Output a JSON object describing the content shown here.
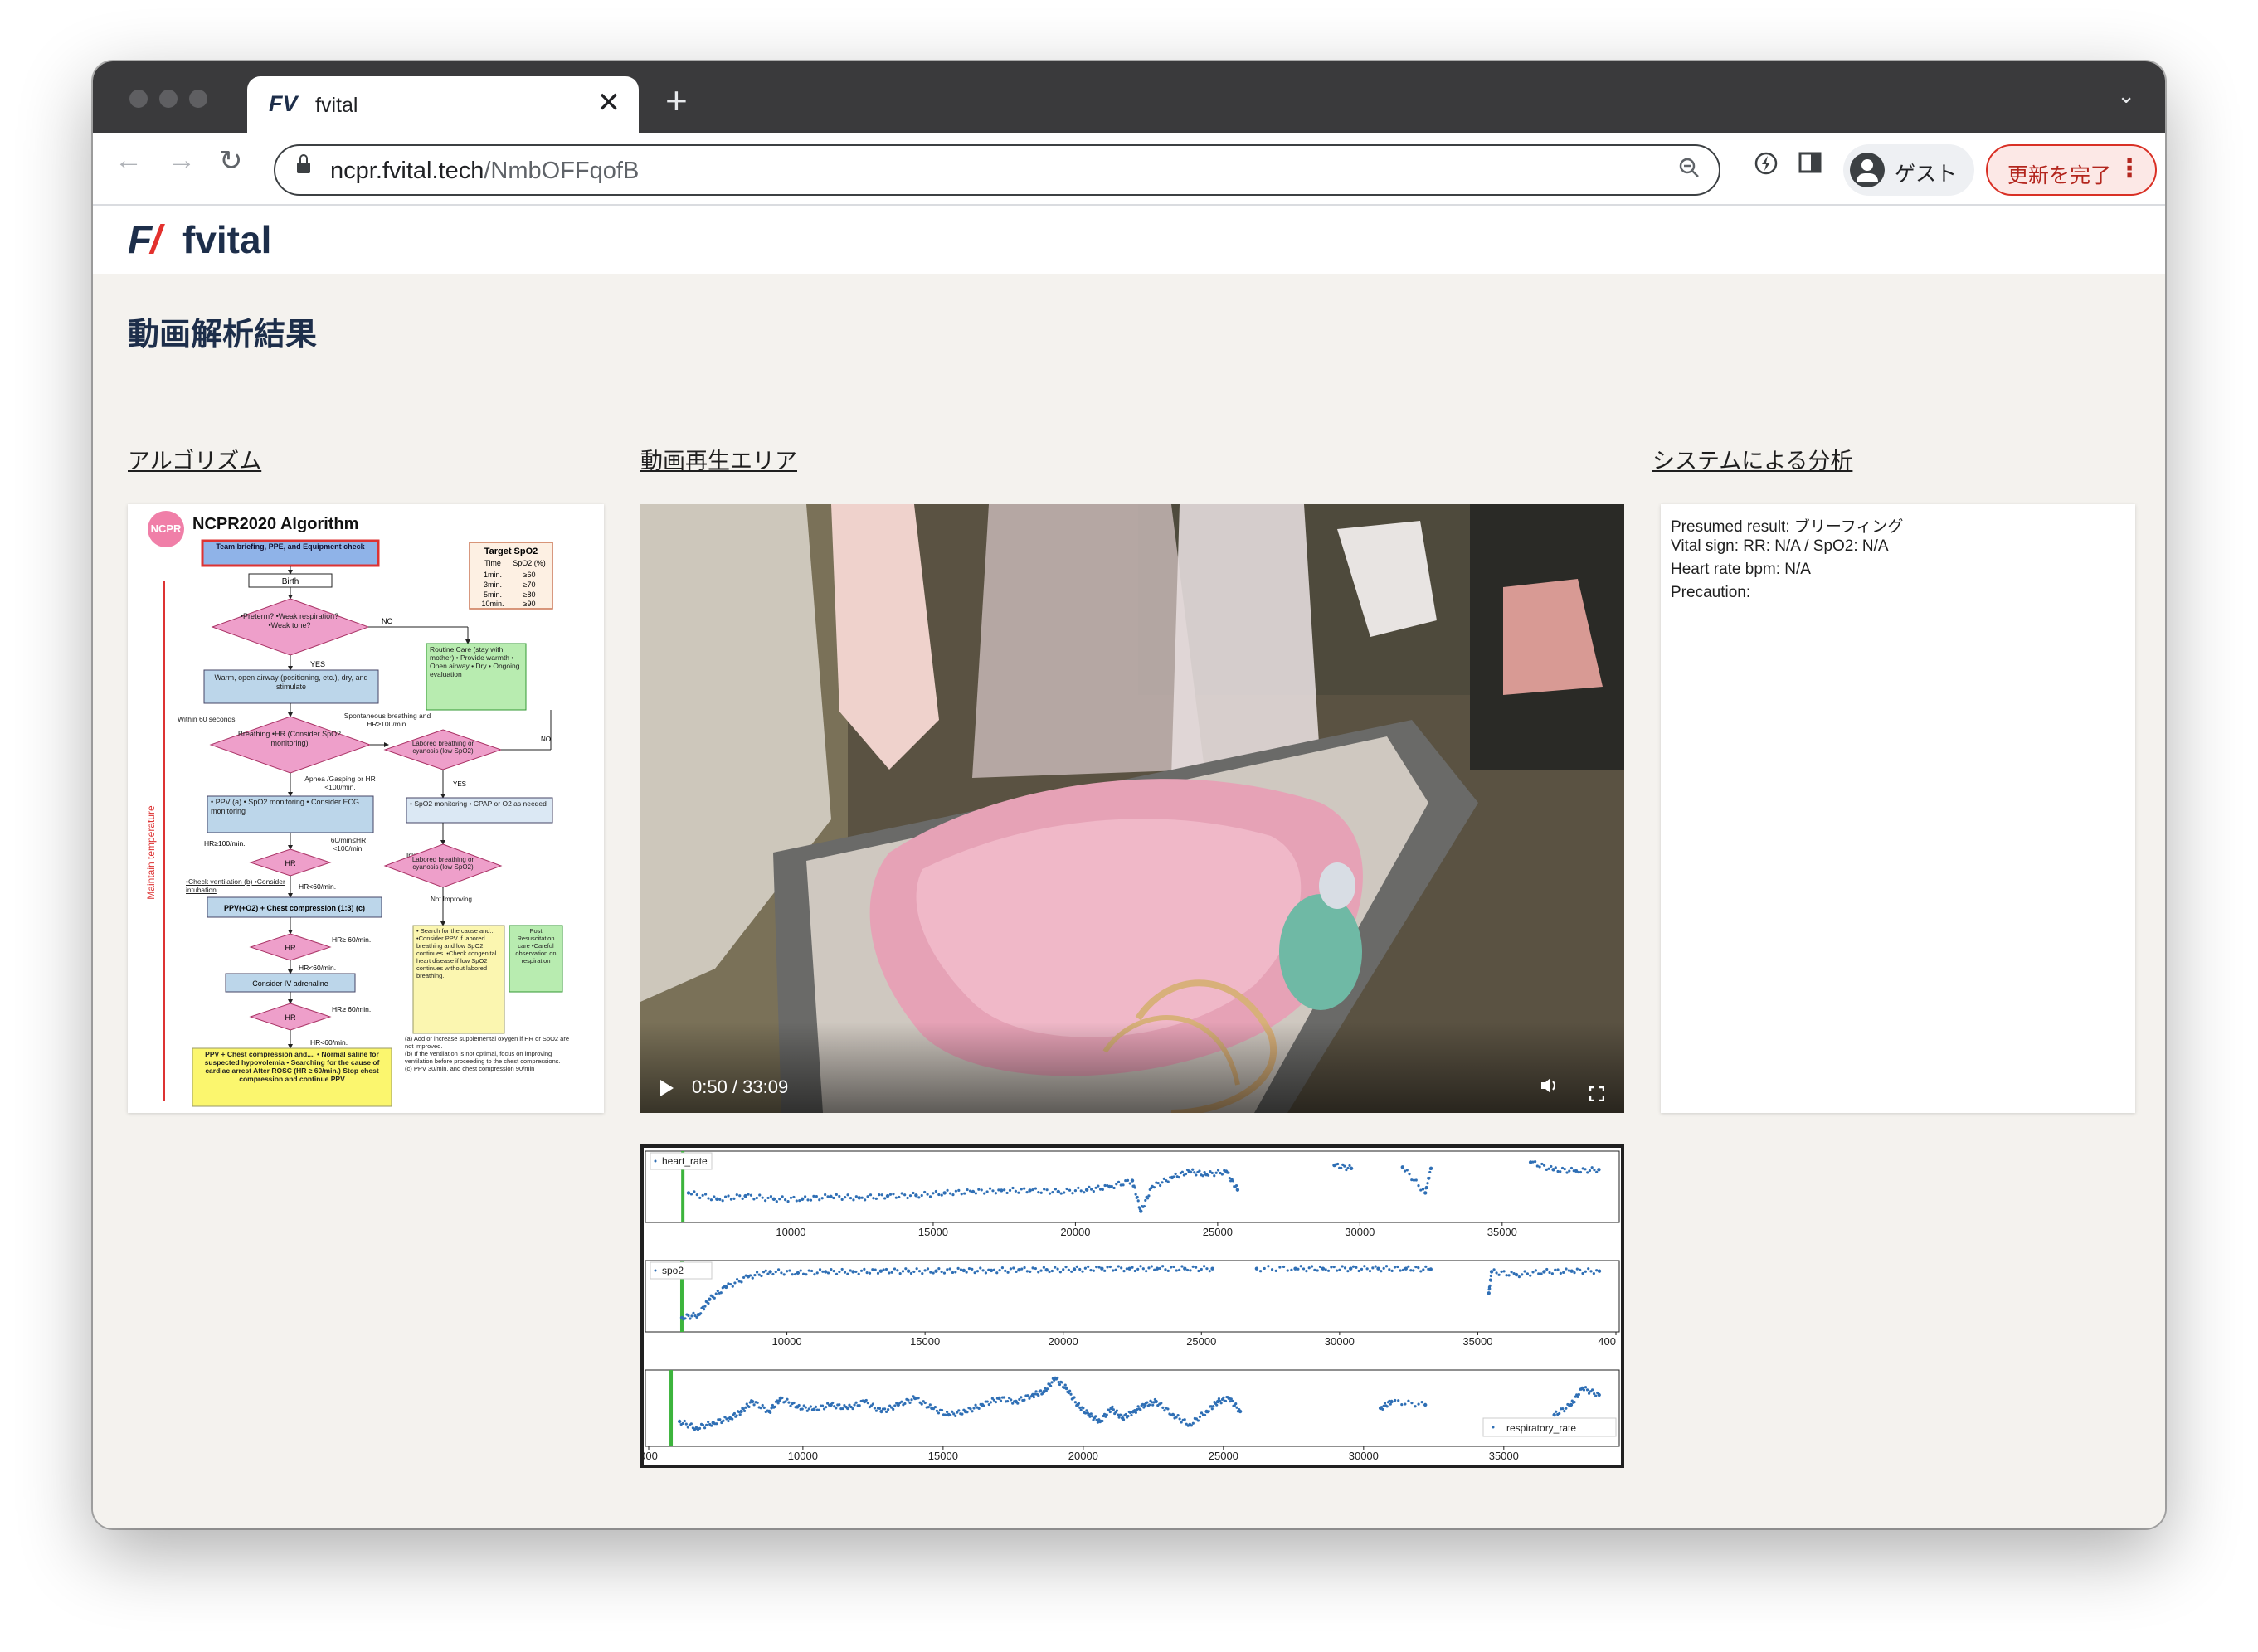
{
  "browser": {
    "tab_logo": "FV",
    "tab_title": "fvital",
    "tab_close": "✕",
    "new_tab": "+",
    "tab_menu": "⌄",
    "url_host": "ncpr.fvital.tech",
    "url_path": "/NmbOFFqofB",
    "profile_name": "ゲスト",
    "update_label": "更新を完了",
    "icons": [
      "back-icon",
      "forward-icon",
      "reload-icon",
      "lock-icon",
      "zoom-icon",
      "extension-icon",
      "side-panel-icon",
      "profile-icon",
      "more-icon"
    ]
  },
  "app": {
    "logo_text": "fvital",
    "page_title": "動画解析結果",
    "sections": {
      "algorithm": "アルゴリズム",
      "video": "動画再生エリア",
      "analysis": "システムによる分析"
    }
  },
  "algorithm_card": {
    "badge": "NCPR",
    "title": "NCPR2020  Algorithm",
    "side_label": "Maintain temperature",
    "target_spo2": {
      "title": "Target SpO2",
      "headers": [
        "Time",
        "SpO2 (%)"
      ],
      "rows": [
        [
          "1min.",
          "≥60"
        ],
        [
          "3min.",
          "≥70"
        ],
        [
          "5min.",
          "≥80"
        ],
        [
          "10min.",
          "≥90"
        ]
      ]
    },
    "boxes": {
      "team": "Team briefing, PPE, and Equipment check",
      "birth": "Birth",
      "preterm": "•Preterm? •Weak respiration? •Weak tone?",
      "routine": "Routine Care (stay with mother) • Provide warmth • Open airway • Dry • Ongoing evaluation",
      "warm": "Warm, open airway (positioning, etc.), dry, and stimulate",
      "breathing": "Breathing •HR (Consider SpO2 monitoring)",
      "labored1": "Labored breathing or cyanosis (low SpO2)",
      "ppv": "• PPV (a) • SpO2 monitoring • Consider ECG monitoring",
      "spo2mon": "• SpO2 monitoring • CPAP or O2 as needed",
      "hr1": "HR",
      "labored2": "Labored breathing or cyanosis (low SpO2)",
      "check": "•Check ventilation (b) •Consider intubation",
      "ppvcc": "PPV(+O2) + Chest compression (1:3) (c)",
      "hr2": "HR",
      "search": "• Search for the cause and... •Consider PPV if labored breathing and low SpO2 continues. •Check congenital heart disease if low SpO2 continues without labored breathing.",
      "post": "Post Resuscitation care •Careful observation on respiration",
      "adrenaline": "Consider IV adrenaline",
      "hr3": "HR",
      "final": "PPV + Chest compression and.... • Normal saline for suspected hypovolemia • Searching for the cause of cardiac arrest After ROSC (HR ≥ 60/min.) Stop chest compression and continue PPV"
    },
    "labels": {
      "no": "NO",
      "yes": "YES",
      "within": "Within 60 seconds",
      "spont": "Spontaneous breathing and HR≥100/min.",
      "apnea": "Apnea /Gasping or HR <100/min.",
      "hr100": "HR≥100/min.",
      "hr60_100": "60/min≤HR <100/min.",
      "hr_lt60": "HR<60/min.",
      "hr_ge60": "HR≥ 60/min.",
      "improving": "Improving",
      "not_improving": "Not Improving",
      "no2": "NO",
      "yes2": "YES"
    },
    "notes": [
      "(a) Add or increase supplemental oxygen if HR or SpO2 are not improved.",
      "(b) If the ventilation is not optimal, focus on improving ventilation before proceeding to the chest compressions.",
      "(c) PPV 30/min. and chest compression 90/min"
    ]
  },
  "video": {
    "time": "0:50 / 33:09",
    "progress": 0.025
  },
  "analysis": {
    "lines": [
      "Presumed result: ブリーフィング",
      "Vital sign: RR: N/A / SpO2: N/A",
      "Heart rate bpm: N/A",
      "Precaution:"
    ]
  },
  "colors": {
    "brand_navy": "#1d2e4a",
    "brand_red": "#e3312d",
    "series": "#2f6fb5",
    "cursor": "#3cb43c",
    "update_red": "#d93025"
  },
  "chart_data": [
    {
      "type": "scatter",
      "legend": "heart_rate",
      "xlim": [
        5000,
        39000
      ],
      "xticks": [
        "10000",
        "15000",
        "20000",
        "25000",
        "30000",
        "35000"
      ],
      "cursor_x": 6200,
      "series": [
        {
          "name": "heart_rate",
          "points": [
            [
              6400,
              0.6
            ],
            [
              7400,
              0.7
            ],
            [
              8400,
              0.65
            ],
            [
              9400,
              0.7
            ],
            [
              10400,
              0.7
            ],
            [
              11400,
              0.66
            ],
            [
              12400,
              0.68
            ],
            [
              13400,
              0.65
            ],
            [
              14400,
              0.64
            ],
            [
              15400,
              0.6
            ],
            [
              16400,
              0.58
            ],
            [
              17400,
              0.56
            ],
            [
              18400,
              0.56
            ],
            [
              19400,
              0.58
            ],
            [
              20400,
              0.55
            ],
            [
              21200,
              0.5
            ],
            [
              22000,
              0.4
            ],
            [
              22300,
              0.9
            ],
            [
              22700,
              0.5
            ],
            [
              23400,
              0.35
            ],
            [
              24000,
              0.25
            ],
            [
              24600,
              0.3
            ],
            [
              25300,
              0.25
            ],
            [
              25700,
              0.55
            ],
            [
              29100,
              0.15
            ],
            [
              29700,
              0.2
            ],
            [
              31500,
              0.18
            ],
            [
              32300,
              0.6
            ],
            [
              32500,
              0.2
            ],
            [
              36000,
              0.1
            ],
            [
              36800,
              0.22
            ],
            [
              37600,
              0.24
            ],
            [
              38400,
              0.22
            ]
          ]
        }
      ]
    },
    {
      "type": "scatter",
      "legend": "spo2",
      "xlim": [
        5000,
        40000
      ],
      "xticks": [
        "10000",
        "15000",
        "20000",
        "25000",
        "30000",
        "35000",
        "400"
      ],
      "cursor_x": 6200,
      "series": [
        {
          "name": "spo2",
          "points": [
            [
              6200,
              0.85
            ],
            [
              6800,
              0.8
            ],
            [
              7200,
              0.55
            ],
            [
              7800,
              0.35
            ],
            [
              8600,
              0.18
            ],
            [
              9400,
              0.1
            ],
            [
              10400,
              0.12
            ],
            [
              11400,
              0.1
            ],
            [
              12400,
              0.1
            ],
            [
              13400,
              0.09
            ],
            [
              14400,
              0.09
            ],
            [
              15400,
              0.09
            ],
            [
              16400,
              0.08
            ],
            [
              17400,
              0.08
            ],
            [
              18400,
              0.07
            ],
            [
              19400,
              0.07
            ],
            [
              20400,
              0.06
            ],
            [
              21400,
              0.05
            ],
            [
              22400,
              0.05
            ],
            [
              23400,
              0.05
            ],
            [
              24400,
              0.05
            ],
            [
              25400,
              0.05
            ],
            [
              27000,
              0.05
            ],
            [
              28400,
              0.05
            ],
            [
              29400,
              0.05
            ],
            [
              30400,
              0.05
            ],
            [
              31400,
              0.05
            ],
            [
              32400,
              0.05
            ],
            [
              33300,
              0.06
            ],
            [
              35400,
              0.45
            ],
            [
              35500,
              0.1
            ],
            [
              36400,
              0.15
            ],
            [
              37400,
              0.1
            ],
            [
              38400,
              0.09
            ],
            [
              39400,
              0.09
            ]
          ]
        }
      ]
    },
    {
      "type": "scatter",
      "legend": "respiratory_rate",
      "xlim": [
        4500,
        39000
      ],
      "xticks": [
        "000",
        "10000",
        "15000",
        "20000",
        "25000",
        "30000",
        "35000"
      ],
      "cursor_x": 5300,
      "series": [
        {
          "name": "respiratory_rate",
          "points": [
            [
              5600,
              0.7
            ],
            [
              6200,
              0.8
            ],
            [
              6800,
              0.72
            ],
            [
              7400,
              0.65
            ],
            [
              7800,
              0.55
            ],
            [
              8200,
              0.4
            ],
            [
              8800,
              0.55
            ],
            [
              9200,
              0.35
            ],
            [
              9800,
              0.48
            ],
            [
              10400,
              0.52
            ],
            [
              11000,
              0.45
            ],
            [
              11600,
              0.5
            ],
            [
              12200,
              0.4
            ],
            [
              12800,
              0.55
            ],
            [
              13400,
              0.45
            ],
            [
              14000,
              0.35
            ],
            [
              14600,
              0.5
            ],
            [
              15200,
              0.6
            ],
            [
              15800,
              0.55
            ],
            [
              16400,
              0.45
            ],
            [
              17000,
              0.35
            ],
            [
              17600,
              0.4
            ],
            [
              18200,
              0.3
            ],
            [
              18600,
              0.25
            ],
            [
              19000,
              0.05
            ],
            [
              19400,
              0.2
            ],
            [
              19800,
              0.45
            ],
            [
              20200,
              0.6
            ],
            [
              20600,
              0.7
            ],
            [
              21000,
              0.5
            ],
            [
              21400,
              0.65
            ],
            [
              21800,
              0.55
            ],
            [
              22200,
              0.45
            ],
            [
              22600,
              0.4
            ],
            [
              23200,
              0.6
            ],
            [
              23800,
              0.75
            ],
            [
              24400,
              0.55
            ],
            [
              24800,
              0.4
            ],
            [
              25200,
              0.35
            ],
            [
              25600,
              0.55
            ],
            [
              30600,
              0.5
            ],
            [
              31000,
              0.4
            ],
            [
              32200,
              0.45
            ],
            [
              36800,
              0.6
            ],
            [
              37400,
              0.45
            ],
            [
              37800,
              0.2
            ],
            [
              38400,
              0.3
            ]
          ]
        }
      ]
    }
  ]
}
